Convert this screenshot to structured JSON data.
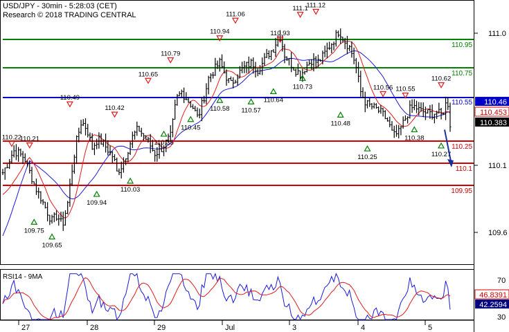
{
  "header": {
    "title": "USD/JPY - 30min - 5:28:03 (CET)",
    "copyright": "Research © 2018 TRADING CENTRAL"
  },
  "colors": {
    "price": "#000000",
    "ma_fast": "#e01b1b",
    "ma_slow": "#1a1ad8",
    "support": "#d00000",
    "pivot": "#0000c8",
    "resistance": "#008000",
    "forecast_arrow": "#1a2f9e",
    "axis_text": "#000000"
  },
  "chart_data": [
    {
      "type": "line",
      "panel": "price",
      "y_axis": {
        "ylim": [
          109.45,
          111.12
        ],
        "ticks": [
          109.6,
          110.1,
          111.0
        ]
      },
      "x_axis": {
        "labels": [
          "27",
          "28",
          "29",
          "Jul",
          "3",
          "4",
          "5"
        ]
      },
      "series": [],
      "close_approx": [
        [
          0,
          110.05
        ],
        [
          2,
          110.12
        ],
        [
          4,
          110.2
        ],
        [
          6,
          110.18
        ],
        [
          8,
          110.15
        ],
        [
          10,
          110.05
        ],
        [
          12,
          109.95
        ],
        [
          14,
          109.88
        ],
        [
          16,
          109.8
        ],
        [
          18,
          109.72
        ],
        [
          20,
          109.76
        ],
        [
          22,
          109.69
        ],
        [
          24,
          109.85
        ],
        [
          25,
          110.0
        ],
        [
          27,
          110.25
        ],
        [
          29,
          110.4
        ],
        [
          31,
          110.35
        ],
        [
          33,
          110.22
        ],
        [
          35,
          110.28
        ],
        [
          37,
          110.25
        ],
        [
          39,
          110.2
        ],
        [
          41,
          110.15
        ],
        [
          42,
          110.05
        ],
        [
          44,
          110.1
        ],
        [
          46,
          110.2
        ],
        [
          48,
          110.3
        ],
        [
          50,
          110.35
        ],
        [
          52,
          110.3
        ],
        [
          54,
          110.25
        ],
        [
          56,
          110.18
        ],
        [
          58,
          110.2
        ],
        [
          60,
          110.25
        ],
        [
          62,
          110.3
        ],
        [
          64,
          110.55
        ],
        [
          66,
          110.6
        ],
        [
          68,
          110.55
        ],
        [
          70,
          110.5
        ],
        [
          72,
          110.42
        ],
        [
          74,
          110.55
        ],
        [
          76,
          110.7
        ],
        [
          78,
          110.75
        ],
        [
          80,
          110.8
        ],
        [
          82,
          110.72
        ],
        [
          84,
          110.65
        ],
        [
          86,
          110.7
        ],
        [
          88,
          110.75
        ],
        [
          90,
          110.78
        ],
        [
          92,
          110.8
        ],
        [
          94,
          110.75
        ],
        [
          96,
          110.8
        ],
        [
          98,
          110.86
        ],
        [
          100,
          110.9
        ],
        [
          102,
          111.0
        ],
        [
          104,
          110.85
        ],
        [
          106,
          110.8
        ],
        [
          108,
          110.75
        ],
        [
          110,
          110.72
        ],
        [
          112,
          110.78
        ],
        [
          114,
          110.82
        ],
        [
          116,
          110.8
        ],
        [
          118,
          110.84
        ],
        [
          120,
          110.9
        ],
        [
          122,
          110.95
        ],
        [
          124,
          111.02
        ],
        [
          126,
          110.95
        ],
        [
          128,
          110.9
        ],
        [
          130,
          110.8
        ],
        [
          132,
          110.6
        ],
        [
          134,
          110.52
        ],
        [
          136,
          110.5
        ],
        [
          138,
          110.48
        ],
        [
          140,
          110.45
        ],
        [
          142,
          110.4
        ],
        [
          144,
          110.3
        ],
        [
          146,
          110.32
        ],
        [
          148,
          110.4
        ],
        [
          150,
          110.48
        ],
        [
          152,
          110.5
        ],
        [
          154,
          110.47
        ],
        [
          156,
          110.46
        ],
        [
          158,
          110.45
        ],
        [
          160,
          110.46
        ],
        [
          162,
          110.44
        ],
        [
          164,
          110.55
        ],
        [
          165,
          110.38
        ]
      ]
    },
    {
      "type": "line",
      "panel": "RSI",
      "title": "RSI14 - 9MA",
      "y_axis": {
        "ylim": [
          24,
          78
        ],
        "ticks": [
          30,
          70
        ]
      },
      "series": [
        {
          "name": "RSI14",
          "last": 42.2594
        },
        {
          "name": "9MA",
          "last": 46.8391
        }
      ]
    }
  ],
  "levels": {
    "resistance": [
      {
        "value": "110.95",
        "y": 110.95
      },
      {
        "value": "110.75",
        "y": 110.75
      }
    ],
    "pivot": {
      "value": "110.55",
      "y": 110.55
    },
    "support": [
      {
        "value": "110.25",
        "y": 110.25
      },
      {
        "value": "110.1",
        "y": 110.1
      },
      {
        "value": "109.95",
        "y": 109.95
      }
    ]
  },
  "axis_labels": {
    "price_ticks": [
      "111.0",
      "110.1",
      "109.6"
    ],
    "rsi_ticks": [
      "70",
      "30"
    ],
    "price_boxes": {
      "ma_slow": "110.46",
      "ma_fast": "110.453",
      "last": "110.383"
    },
    "rsi_boxes": {
      "ma": "46.8391",
      "rsi": "42.2594"
    }
  },
  "highs": [
    {
      "text": "110.22",
      "bar": 4
    },
    {
      "text": "110.21",
      "bar": 12
    },
    {
      "text": "110.49",
      "bar": 30
    },
    {
      "text": "110.42",
      "bar": 50
    },
    {
      "text": "110.65",
      "bar": 65
    },
    {
      "text": "110.79",
      "bar": 75
    },
    {
      "text": "110.94",
      "bar": 97
    },
    {
      "text": "111.06",
      "bar": 104
    },
    {
      "text": "110.93",
      "bar": 124
    },
    {
      "text": "111.1",
      "bar": 133
    },
    {
      "text": "111.12",
      "bar": 140
    },
    {
      "text": "110.56",
      "bar": 170
    },
    {
      "text": "110.55",
      "bar": 180
    },
    {
      "text": "110.62",
      "bar": 196
    }
  ],
  "lows": [
    {
      "text": "109.75",
      "bar": 14
    },
    {
      "text": "109.65",
      "bar": 22
    },
    {
      "text": "109.94",
      "bar": 42
    },
    {
      "text": "110.03",
      "bar": 57
    },
    {
      "text": "110.35",
      "bar": 72
    },
    {
      "text": "110.45",
      "bar": 84
    },
    {
      "text": "110.58",
      "bar": 97
    },
    {
      "text": "110.57",
      "bar": 111
    },
    {
      "text": "110.64",
      "bar": 121
    },
    {
      "text": "110.73",
      "bar": 134
    },
    {
      "text": "110.48",
      "bar": 151
    },
    {
      "text": "110.25",
      "bar": 163
    },
    {
      "text": "110.38",
      "bar": 184
    },
    {
      "text": "110.27",
      "bar": 196
    }
  ],
  "forecast": {
    "target": "110.1"
  }
}
